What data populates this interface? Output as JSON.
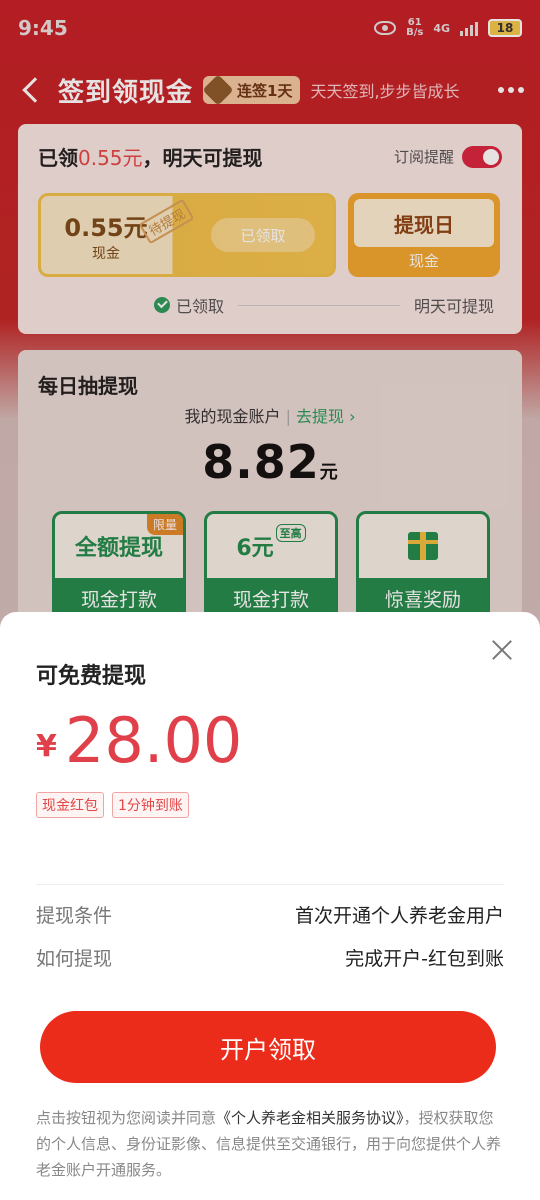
{
  "status_bar": {
    "time": "9:45",
    "net_speed_top": "61",
    "net_speed_bottom": "B/s",
    "network_type": "4G",
    "battery": "18"
  },
  "nav": {
    "title": "签到领现金",
    "streak_badge": "连签1天",
    "subtitle": "天天签到,步步皆成长"
  },
  "checkin_card": {
    "title_prefix": "已领",
    "title_amount": "0.55元",
    "title_suffix": "，明天可提现",
    "subscribe_label": "订阅提醒",
    "subscribe_on": true,
    "reward_amount": "0.55元",
    "reward_unit": "现金",
    "pending_stamp": "待提现",
    "claimed_button": "已领取",
    "withdraw_day_label": "提现日",
    "withdraw_day_unit": "现金",
    "progress_done": "已领取",
    "progress_tomorrow": "明天可提现"
  },
  "daily_card": {
    "title": "每日抽提现",
    "account_label": "我的现金账户",
    "account_link": "去提现",
    "balance": "8.82",
    "balance_unit": "元",
    "tiles": [
      {
        "main": "全额提现",
        "tag": "限量",
        "foot": "现金打款"
      },
      {
        "main": "6元",
        "sup": "至高",
        "foot": "现金打款"
      },
      {
        "main": "",
        "foot": "惊喜奖励"
      }
    ]
  },
  "sheet": {
    "title": "可免费提现",
    "currency_symbol": "¥",
    "amount": "28.00",
    "tags": [
      "现金红包",
      "1分钟到账"
    ],
    "rows": [
      {
        "label": "提现条件",
        "value": "首次开通个人养老金用户"
      },
      {
        "label": "如何提现",
        "value": "完成开户-红包到账"
      }
    ],
    "cta_label": "开户领取",
    "disclaimer_prefix": "点击按钮视为您阅读并同意",
    "disclaimer_link": "《个人养老金相关服务协议》",
    "disclaimer_suffix": "，授权获取您的个人信息、身份证影像、信息提供至交通银行，用于向您提供个人养老金账户开通服务。"
  },
  "colors": {
    "brand_red": "#d8222a",
    "price_red": "#e0404a",
    "cta_red": "#ec2c1b",
    "green": "#1f8b4c"
  }
}
